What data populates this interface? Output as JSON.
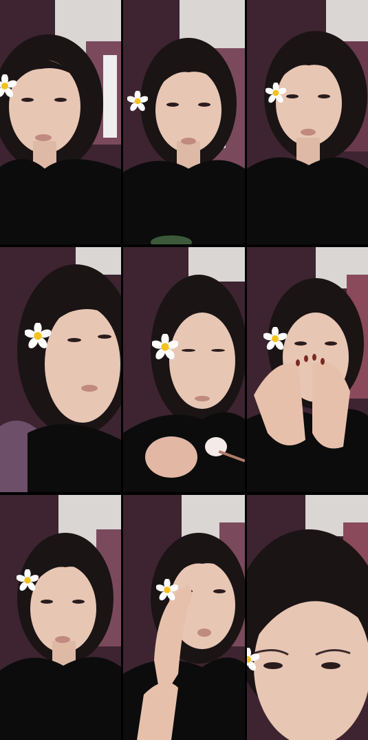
{
  "collage": {
    "rows": 3,
    "columns": 3,
    "frames": [
      {
        "subject": "person-talking",
        "flower_icon": "plumeria-flower-icon"
      },
      {
        "subject": "person-talking",
        "flower_icon": "plumeria-flower-icon"
      },
      {
        "subject": "person-looking-aside",
        "flower_icon": "plumeria-flower-icon"
      },
      {
        "subject": "person-leaning-close",
        "flower_icon": "plumeria-flower-icon"
      },
      {
        "subject": "person-applying-makeup",
        "flower_icon": "plumeria-flower-icon"
      },
      {
        "subject": "person-hands-over-face",
        "flower_icon": "plumeria-flower-icon"
      },
      {
        "subject": "person-facing-camera",
        "flower_icon": "plumeria-flower-icon"
      },
      {
        "subject": "person-touching-eye",
        "flower_icon": "plumeria-flower-icon"
      },
      {
        "subject": "person-close-up",
        "flower_icon": "plumeria-flower-icon"
      }
    ]
  },
  "colors": {
    "curtain": "#3d2430",
    "wall": "#d9d6d4",
    "hair": "#1a1414",
    "skin": "#e8c6b4",
    "shirt": "#0c0c0c",
    "flower_petal": "#ffffff",
    "flower_center": "#f4c21c",
    "nails": "#7a2a22"
  }
}
